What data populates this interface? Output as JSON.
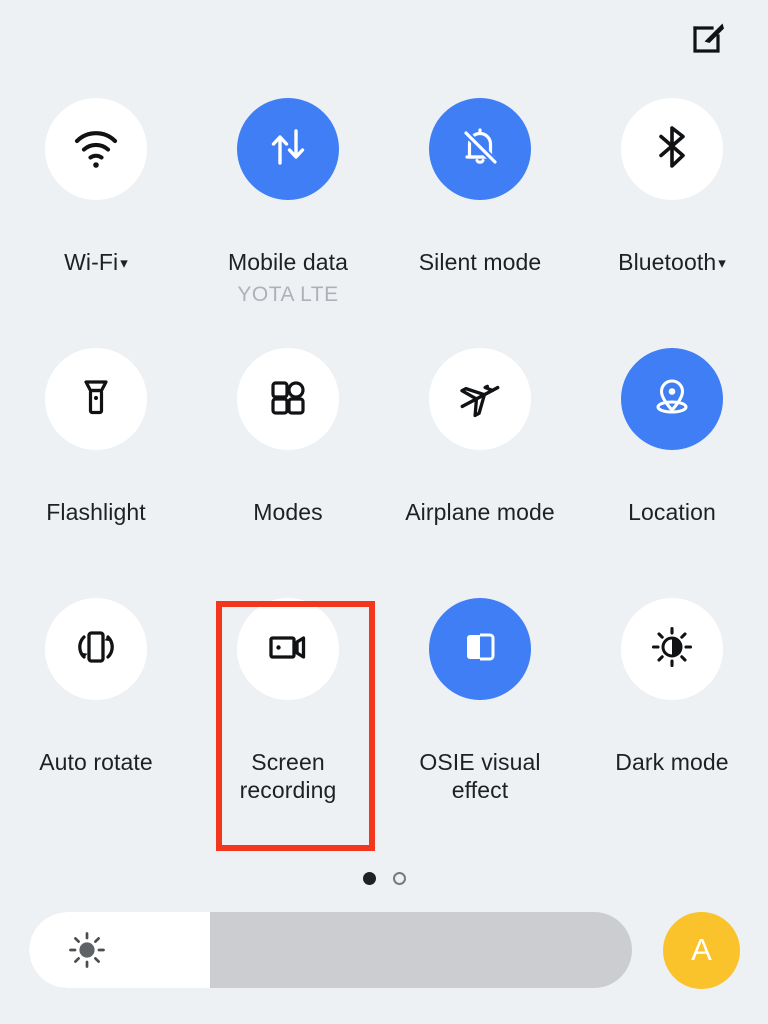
{
  "header": {
    "edit_icon": "edit-pencil-square-icon"
  },
  "colors": {
    "background": "#eef1f4",
    "tile_off": "#ffffff",
    "tile_on": "#3f7ef4",
    "label": "#1f2023",
    "sublabel": "#aeb2b8",
    "highlight": "#f4371c",
    "auto_brightness": "#fac32c",
    "slider_track": "#cbcdd1",
    "slider_fill": "#ffffff"
  },
  "quick_settings": {
    "rows": [
      [
        {
          "label": "Wi-Fi",
          "caret": "▾",
          "icon": "wifi-icon",
          "active": false,
          "sub": ""
        },
        {
          "label": "Mobile data",
          "caret": "",
          "icon": "mobile-data-icon",
          "active": true,
          "sub": "YOTA LTE"
        },
        {
          "label": "Silent mode",
          "caret": "",
          "icon": "bell-off-icon",
          "active": true,
          "sub": ""
        },
        {
          "label": "Bluetooth",
          "caret": "▾",
          "icon": "bluetooth-icon",
          "active": false,
          "sub": ""
        }
      ],
      [
        {
          "label": "Flashlight",
          "caret": "",
          "icon": "flashlight-icon",
          "active": false,
          "sub": ""
        },
        {
          "label": "Modes",
          "caret": "",
          "icon": "modes-grid-icon",
          "active": false,
          "sub": ""
        },
        {
          "label": "Airplane mode",
          "caret": "",
          "icon": "airplane-icon",
          "active": false,
          "sub": ""
        },
        {
          "label": "Location",
          "caret": "",
          "icon": "location-pin-icon",
          "active": true,
          "sub": ""
        }
      ],
      [
        {
          "label": "Auto rotate",
          "caret": "",
          "icon": "auto-rotate-icon",
          "active": false,
          "sub": ""
        },
        {
          "label": "Screen\nrecording",
          "caret": "",
          "icon": "screen-recording-icon",
          "active": false,
          "sub": ""
        },
        {
          "label": "OSIE visual\neffect",
          "caret": "",
          "icon": "osie-split-icon",
          "active": true,
          "sub": ""
        },
        {
          "label": "Dark mode",
          "caret": "",
          "icon": "dark-mode-icon",
          "active": false,
          "sub": ""
        }
      ]
    ]
  },
  "highlight": {
    "target": "Screen recording",
    "color": "#f4371c"
  },
  "pager": {
    "pages": 2,
    "current": 1
  },
  "brightness": {
    "icon": "brightness-sun-icon",
    "fill_percent": 30,
    "auto_label": "A",
    "auto_icon": "auto-brightness-button"
  }
}
